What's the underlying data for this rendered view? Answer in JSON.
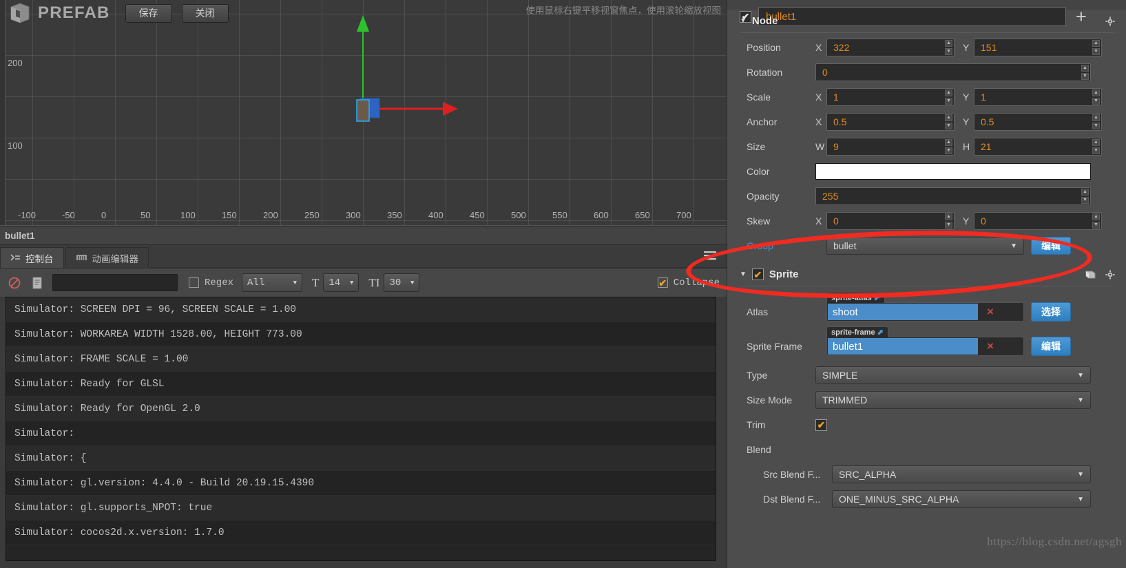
{
  "window": {
    "prefab_title": "PREFAB",
    "save_label": "保存",
    "close_label": "关闭",
    "scene_hint": "使用鼠标右键平移视窗焦点，使用滚轮缩放视图",
    "selected_node_label": "bullet1",
    "watermark": "https://blog.csdn.net/agsgh"
  },
  "scene": {
    "ruler_y": [
      "200",
      "100"
    ],
    "ruler_x": [
      "-100",
      "-50",
      "0",
      "50",
      "100",
      "150",
      "200",
      "250",
      "300",
      "350",
      "400",
      "450",
      "500",
      "550",
      "600",
      "650",
      "700"
    ],
    "gizmo": {
      "x_axis_color": "#e02020",
      "y_axis_color": "#2dc22d",
      "selection_color": "#2c7de0"
    }
  },
  "bottom_panel": {
    "tabs": [
      {
        "label": "控制台",
        "icon": "console-icon",
        "active": true
      },
      {
        "label": "动画编辑器",
        "icon": "animation-icon",
        "active": false
      }
    ],
    "toolbar": {
      "clear_icon": "ban-icon",
      "copy_icon": "document-icon",
      "search_value": "",
      "regex_label": "Regex",
      "regex_checked": false,
      "level_filter": "All",
      "font_size": "14",
      "line_height": "30",
      "collapse_label": "Collapse",
      "collapse_checked": true,
      "menu_icon": "hamburger-icon"
    },
    "log_lines": [
      "Simulator: SCREEN DPI = 96, SCREEN SCALE = 1.00",
      "Simulator: WORKAREA WIDTH 1528.00, HEIGHT 773.00",
      "Simulator: FRAME SCALE = 1.00",
      "Simulator: Ready for GLSL",
      "Simulator: Ready for OpenGL 2.0",
      "Simulator:",
      "Simulator: {",
      "Simulator: gl.version: 4.4.0 - Build 20.19.15.4390",
      "Simulator: gl.supports_NPOT: true",
      "Simulator: cocos2d.x.version: 1.7.0"
    ]
  },
  "inspector": {
    "node_name": "bullet1",
    "node_enabled": true,
    "add_component_icon": "plus-icon",
    "node_section": {
      "title": "Node",
      "expanded": true,
      "gear_icon": "gear-icon",
      "position": {
        "label": "Position",
        "x_axis": "X",
        "x": "322",
        "y_axis": "Y",
        "y": "151"
      },
      "rotation": {
        "label": "Rotation",
        "value": "0"
      },
      "scale": {
        "label": "Scale",
        "x_axis": "X",
        "x": "1",
        "y_axis": "Y",
        "y": "1"
      },
      "anchor": {
        "label": "Anchor",
        "x_axis": "X",
        "x": "0.5",
        "y_axis": "Y",
        "y": "0.5"
      },
      "size": {
        "label": "Size",
        "w_axis": "W",
        "w": "9",
        "h_axis": "H",
        "h": "21"
      },
      "color": {
        "label": "Color",
        "value": "#ffffff"
      },
      "opacity": {
        "label": "Opacity",
        "value": "255"
      },
      "skew": {
        "label": "Skew",
        "x_axis": "X",
        "x": "0",
        "y_axis": "Y",
        "y": "0"
      },
      "group": {
        "label": "Group",
        "value": "bullet",
        "edit_label": "编辑"
      }
    },
    "sprite_section": {
      "title": "Sprite",
      "expanded": true,
      "enabled": true,
      "book_icon": "book-icon",
      "gear_icon": "gear-icon",
      "atlas": {
        "label": "Atlas",
        "tag": "sprite-atlas",
        "value": "shoot",
        "clear": "×",
        "button": "选择"
      },
      "sprite_frame": {
        "label": "Sprite Frame",
        "tag": "sprite-frame",
        "value": "bullet1",
        "clear": "×",
        "button": "编辑"
      },
      "type": {
        "label": "Type",
        "value": "SIMPLE"
      },
      "size_mode": {
        "label": "Size Mode",
        "value": "TRIMMED"
      },
      "trim": {
        "label": "Trim",
        "checked": true
      },
      "blend": {
        "label": "Blend"
      },
      "src_blend": {
        "label": "Src Blend F...",
        "value": "SRC_ALPHA"
      },
      "dst_blend": {
        "label": "Dst Blend F...",
        "value": "ONE_MINUS_SRC_ALPHA"
      }
    }
  }
}
